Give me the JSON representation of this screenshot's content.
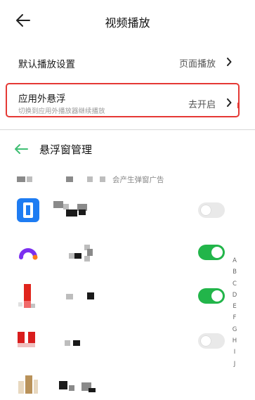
{
  "header": {
    "title": "视频播放"
  },
  "settings": {
    "default_play": {
      "label": "默认播放设置",
      "value": "页面播放"
    },
    "floating": {
      "title": "应用外悬浮",
      "subtitle": "切换到应用外播放器继续播放",
      "value": "去开启"
    }
  },
  "manager": {
    "title": "悬浮窗管理",
    "hint": "会产生弹窗广告",
    "apps": [
      {
        "icon": "app-icon-blue",
        "enabled": false
      },
      {
        "icon": "app-icon-purple-arc",
        "enabled": true
      },
      {
        "icon": "app-icon-red",
        "enabled": true
      },
      {
        "icon": "app-icon-red-pair",
        "enabled": false
      },
      {
        "icon": "app-icon-beige",
        "enabled": null
      }
    ]
  },
  "alphabet_index": [
    "A",
    "B",
    "C",
    "D",
    "E",
    "F",
    "G",
    "H",
    "I",
    "J"
  ],
  "colors": {
    "toggle_on": "#22b54a",
    "highlight": "#e53935"
  }
}
